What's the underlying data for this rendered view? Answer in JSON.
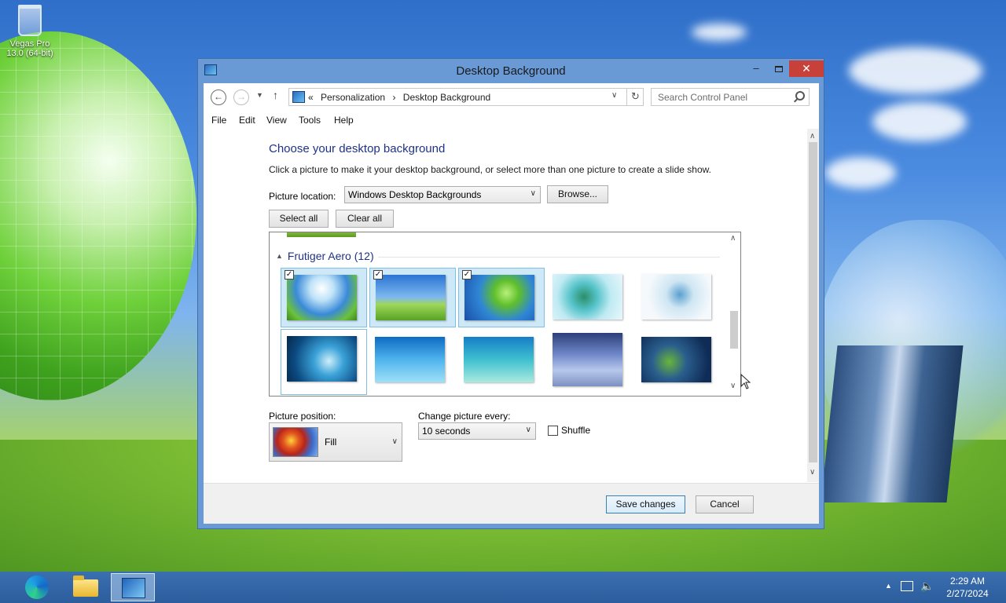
{
  "desktop": {
    "icons": [
      {
        "label": "Vegas Pro 13.0 (64-bit)"
      }
    ]
  },
  "window": {
    "title": "Desktop Background",
    "controls": {
      "minimize": "–",
      "close": "✕"
    }
  },
  "nav": {
    "breadcrumb": [
      "«",
      "Personalization",
      "›",
      "Desktop Background"
    ],
    "search_placeholder": "Search Control Panel"
  },
  "menu": [
    "File",
    "Edit",
    "View",
    "Tools",
    "Help"
  ],
  "content": {
    "heading": "Choose your desktop background",
    "description": "Click a picture to make it your desktop background, or select more than one picture to create a slide show.",
    "picture_location_label": "Picture location:",
    "picture_location_value": "Windows Desktop Backgrounds",
    "browse_label": "Browse...",
    "select_all_label": "Select all",
    "clear_all_label": "Clear all",
    "group": {
      "name": "Frutiger Aero (12)",
      "tiles": [
        {
          "selected": true
        },
        {
          "selected": true
        },
        {
          "selected": true
        },
        {
          "selected": false
        },
        {
          "selected": false
        },
        {
          "selected": false
        },
        {
          "selected": false
        },
        {
          "selected": false
        },
        {
          "selected": false
        },
        {
          "selected": false
        }
      ]
    },
    "picture_position_label": "Picture position:",
    "picture_position_value": "Fill",
    "change_every_label": "Change picture every:",
    "change_every_value": "10 seconds",
    "shuffle_label": "Shuffle",
    "shuffle_checked": false
  },
  "footer": {
    "save_label": "Save changes",
    "cancel_label": "Cancel"
  },
  "taskbar": {
    "time": "2:29 AM",
    "date": "2/27/2024"
  },
  "colors": {
    "heading": "#1e3287",
    "close_button": "#c7413a",
    "selection": "#cde8f7",
    "taskbar": "#2c5d9d"
  }
}
